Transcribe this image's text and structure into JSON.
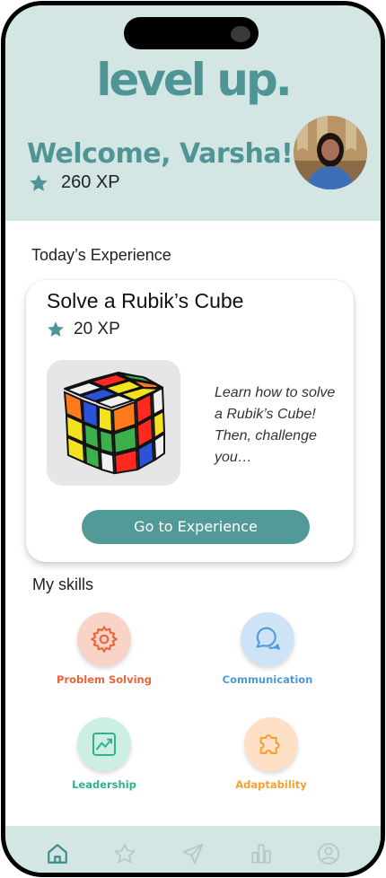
{
  "app": {
    "logo": "level up."
  },
  "header": {
    "welcome": "Welcome, Varsha!",
    "xp": "260 XP"
  },
  "today": {
    "section_title": "Today’s Experience",
    "card": {
      "title": "Solve a Rubik’s Cube",
      "xp": "20 XP",
      "description": "Learn how to solve a Rubik’s Cube! Then, challenge you…",
      "button": "Go to Experience"
    }
  },
  "skills": {
    "section_title": "My skills",
    "items": [
      {
        "label": "Problem Solving",
        "icon": "gear-icon",
        "color": "#e9643a",
        "bg": "#f8d3c6"
      },
      {
        "label": "Communication",
        "icon": "chat-bubbles-icon",
        "color": "#4a9be0",
        "bg": "#cfe3f7"
      },
      {
        "label": "Leadership",
        "icon": "trend-chart-icon",
        "color": "#2fb28e",
        "bg": "#cdeee2"
      },
      {
        "label": "Adaptability",
        "icon": "puzzle-icon",
        "color": "#f2a233",
        "bg": "#fde0c5"
      }
    ]
  },
  "tabbar": {
    "items": [
      {
        "icon": "home-icon",
        "active": true
      },
      {
        "icon": "star-icon",
        "active": false
      },
      {
        "icon": "send-icon",
        "active": false
      },
      {
        "icon": "bar-chart-icon",
        "active": false
      },
      {
        "icon": "profile-icon",
        "active": false
      }
    ]
  },
  "colors": {
    "brand": "#4f9595",
    "header_bg": "#d3e6e3",
    "button": "#529a98"
  }
}
